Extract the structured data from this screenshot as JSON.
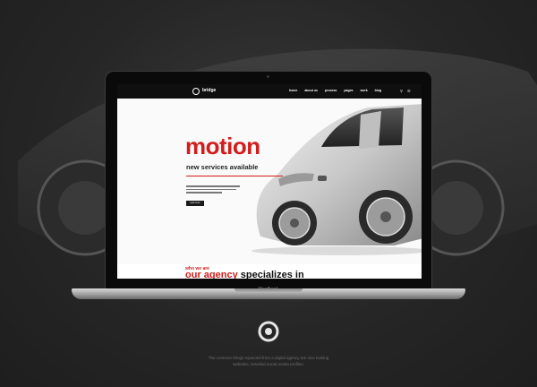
{
  "site": {
    "logo": "bridge",
    "nav": [
      "home",
      "about us",
      "process",
      "pages",
      "work",
      "blog"
    ],
    "hero": {
      "title": "motion",
      "subtitle": "new services available",
      "button": "read more"
    },
    "section": {
      "kicker": "who we are",
      "headline_accent": "our agency",
      "headline_rest": "specializes in"
    }
  },
  "device": {
    "label": "MacBook"
  },
  "footer": {
    "line1": "The common things expected from a digital agency are nice looking",
    "line2": "websites, branded social media profiles."
  },
  "colors": {
    "accent": "#d21d1d",
    "background": "#2a2a2a"
  },
  "icons": [
    "search-icon",
    "menu-icon",
    "brand-logo-icon"
  ]
}
